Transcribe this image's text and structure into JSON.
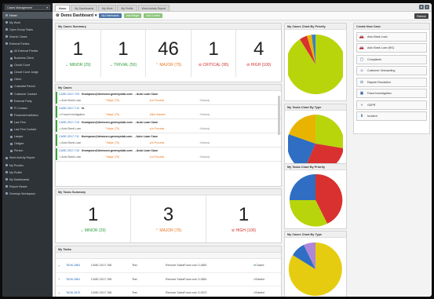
{
  "sidebar": {
    "app_select": "Cases Management",
    "items": [
      {
        "label": "Home",
        "sub": false,
        "active": true
      },
      {
        "label": "My Work",
        "sub": false
      },
      {
        "label": "Open Group Tasks",
        "sub": false
      },
      {
        "label": "Search Cases",
        "sub": false
      },
      {
        "label": "External Parties",
        "sub": false
      },
      {
        "label": "All External Parties",
        "sub": true
      },
      {
        "label": "Business Client",
        "sub": true
      },
      {
        "label": "Circuit Court",
        "sub": true
      },
      {
        "label": "Circuit Court Judge",
        "sub": true
      },
      {
        "label": "Client",
        "sub": true
      },
      {
        "label": "Custodial Parent",
        "sub": true
      },
      {
        "label": "Customer Contact",
        "sub": true
      },
      {
        "label": "External Party",
        "sub": true
      },
      {
        "label": "FI Contact",
        "sub": true
      },
      {
        "label": "Financial Institution",
        "sub": true
      },
      {
        "label": "Law Firm",
        "sub": true
      },
      {
        "label": "Law Firm Contact",
        "sub": true
      },
      {
        "label": "Lawyer",
        "sub": true
      },
      {
        "label": "Obligee",
        "sub": true
      },
      {
        "label": "Person",
        "sub": true
      },
      {
        "label": "Work Activity Report",
        "sub": false
      },
      {
        "label": "My Proxies",
        "sub": false
      },
      {
        "label": "My Profile",
        "sub": false
      },
      {
        "label": "My Dashboards",
        "sub": false
      },
      {
        "label": "Report Viewer",
        "sub": false
      },
      {
        "label": "Genesys Workspace",
        "sub": false
      }
    ]
  },
  "tabs": [
    "Home",
    "My Dashboards",
    "My Work",
    "My Profile",
    "Work Activity Report"
  ],
  "toolbar": {
    "title": "Demo Dashboard",
    "my_dashboards": "My Dashboards",
    "add_widget": "Add Widget",
    "add_content": "Add Content",
    "refresh": "Refresh"
  },
  "cases_summary": {
    "title": "My Cases Summary",
    "cells": [
      {
        "value": "1",
        "label": "MINOR (29)",
        "tone": "green",
        "icon": "chevron-down"
      },
      {
        "value": "1",
        "label": "TRIVIAL (50)",
        "tone": "green",
        "icon": "chevron-down"
      },
      {
        "value": "46",
        "label": "MAJOR (75)",
        "tone": "orange",
        "icon": "chevron-up"
      },
      {
        "value": "1",
        "label": "CRITICAL (95)",
        "tone": "red",
        "icon": "ban"
      },
      {
        "value": "4",
        "label": "HIGH (100)",
        "tone": "red",
        "icon": "ban"
      }
    ]
  },
  "cases": {
    "title": "My Cases",
    "rows": [
      {
        "id": "CASE-2017-729",
        "email": "thompson@demosrv.genesyslab.com",
        "subject": "- Auto Loan Case",
        "type": "Auto Bank Loan",
        "priority": "Major (75)",
        "status": "In Process",
        "owner": "Nobody"
      },
      {
        "id": "CASE-2017-712",
        "email": "fs",
        "subject": "",
        "type": "Fraud Investigation",
        "priority": "Major (75)",
        "status": "Not Started",
        "owner": "Nobody"
      },
      {
        "id": "CASE-2017-713",
        "email": "thompson@demosrv.genesyslab.com",
        "subject": "- Auto Loan Case",
        "type": "Auto Bank Loan",
        "priority": "Major (75)",
        "status": "In Process",
        "owner": "Nobody"
      },
      {
        "id": "CASE-2017-711",
        "email": "thompson@demosrv.genesyslab.com",
        "subject": "- Auto Loan Case",
        "type": "Auto Bank Loan",
        "priority": "Major (75)",
        "status": "In Process",
        "owner": "Nobody"
      },
      {
        "id": "CASE-2017-710",
        "email": "thompson@demosrv.genesyslab.com",
        "subject": "- Auto Loan Case",
        "type": "Auto Bank Loan",
        "priority": "Major (75)",
        "status": "In Process",
        "owner": "Nobody"
      }
    ]
  },
  "tasks_summary": {
    "title": "My Tasks Summary",
    "cells": [
      {
        "value": "1",
        "label": "MINOR (29)",
        "tone": "green",
        "icon": "chevron-down"
      },
      {
        "value": "3",
        "label": "MAJOR (75)",
        "tone": "orange",
        "icon": "chevron-up"
      },
      {
        "value": "1",
        "label": "HIGH (100)",
        "tone": "red",
        "icon": "ban"
      }
    ]
  },
  "tasks": {
    "title": "My Tasks",
    "rows": [
      {
        "id": "TASK-2881",
        "case": "CASE-2017-768",
        "who": "Test",
        "desc": "Remove SalesForce.com 3-2881",
        "status": "Closed"
      },
      {
        "id": "TASK-2861",
        "case": "CASE-2017-768",
        "who": "Test",
        "desc": "Remove SalesForce.com 3-2861",
        "status": "Started"
      },
      {
        "id": "TASK-2872",
        "case": "CASE-2017-768",
        "who": "Test",
        "desc": "Remove SalesForce.com 3-2872",
        "status": "Started"
      }
    ]
  },
  "charts": {
    "cases_by_priority": "My Cases Chart By Priority",
    "tasks_by_type": "My Tasks Chart By Type",
    "tasks_by_priority": "My Tasks Chart By Priority",
    "cases_by_type": "My Cases Chart By Type"
  },
  "create_case": {
    "title": "Create New Case",
    "buttons": [
      {
        "label": "Auto Bank Loan",
        "icon": "car-icon"
      },
      {
        "label": "Auto Bank Loan (NS)",
        "icon": "car-icon"
      },
      {
        "label": "Complaints",
        "icon": "folder-icon"
      },
      {
        "label": "Customer Onboarding",
        "icon": "user-icon"
      },
      {
        "label": "Dispute Resolution",
        "icon": "scale-icon"
      },
      {
        "label": "Fraud Investigation",
        "icon": "money-icon"
      },
      {
        "label": "GDPR",
        "icon": "chevrons-icon"
      },
      {
        "label": "Incident",
        "icon": "download-icon"
      }
    ]
  },
  "colors": {
    "green": "#2c9b3a",
    "orange": "#e8741c",
    "red": "#d22d2d",
    "link": "#2366b8"
  }
}
